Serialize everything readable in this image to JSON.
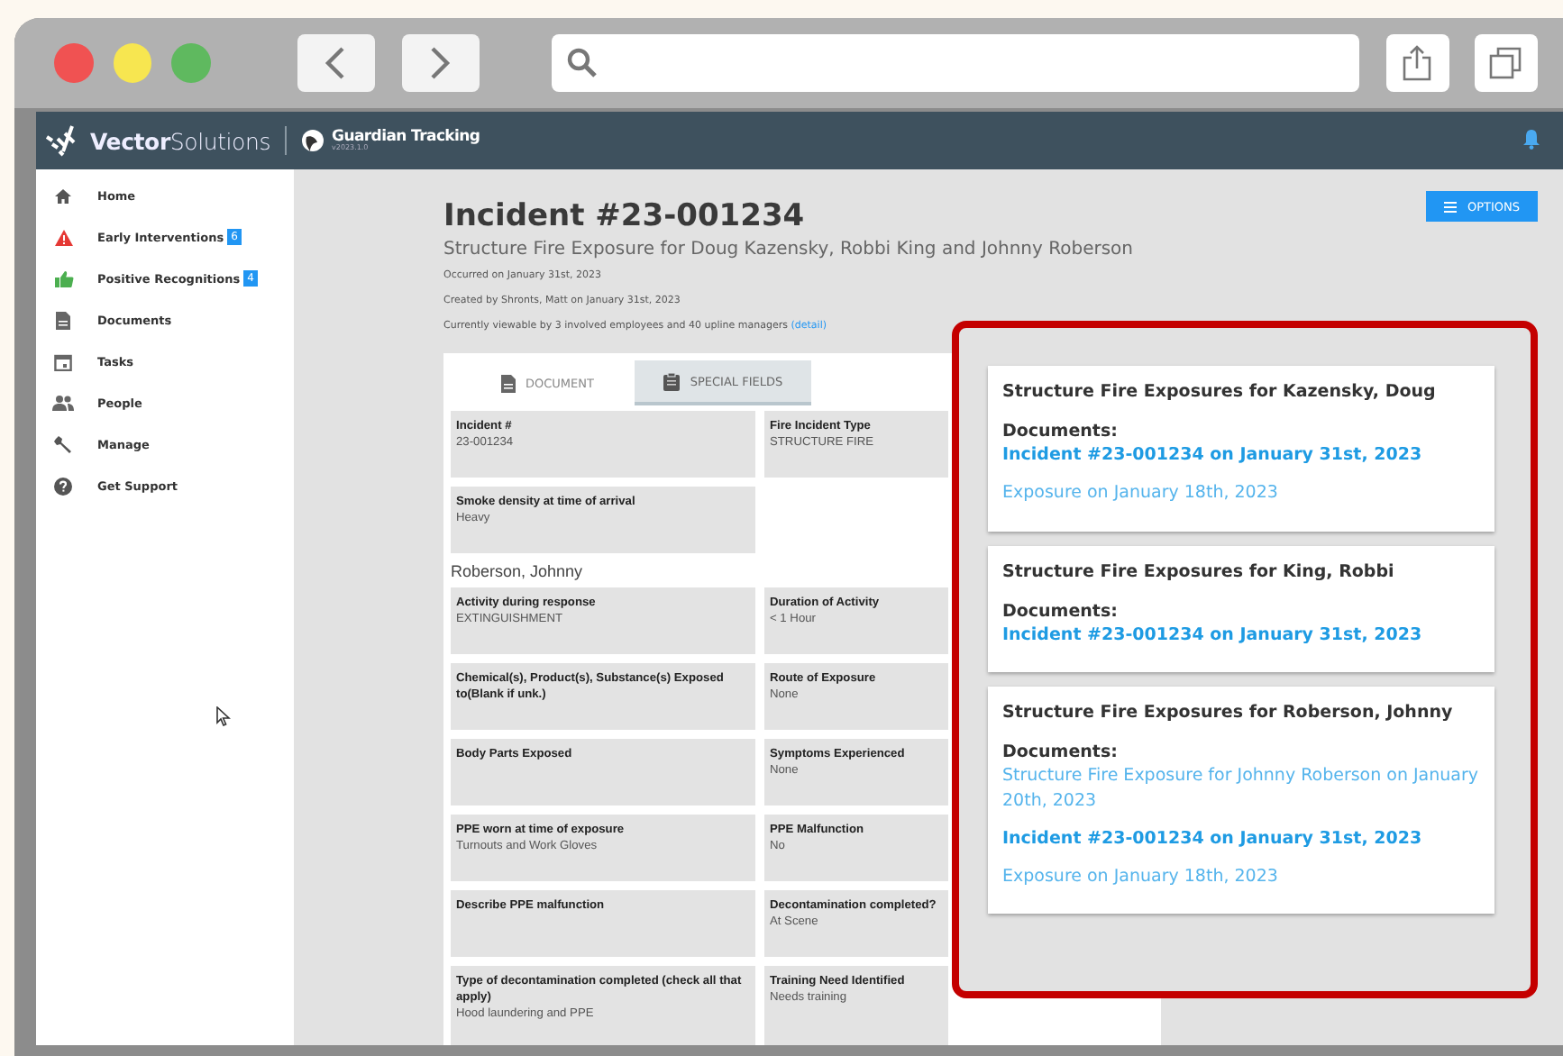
{
  "app": {
    "brand": "**Vector**Solutions",
    "product": "Guardian Tracking",
    "version": "v2023.1.0"
  },
  "sidebar": {
    "items": [
      {
        "label": "Home",
        "kind": "home"
      },
      {
        "label": "Early Interventions",
        "kind": "warning",
        "badge": "6"
      },
      {
        "label": "Positive Recognitions",
        "kind": "thumb",
        "badge": "4"
      },
      {
        "label": "Documents",
        "kind": "document"
      },
      {
        "label": "Tasks",
        "kind": "calendar"
      },
      {
        "label": "People",
        "kind": "people"
      },
      {
        "label": "Manage",
        "kind": "wrench"
      },
      {
        "label": "Get Support",
        "kind": "help"
      }
    ]
  },
  "incident": {
    "title": "Incident #23-001234",
    "subtitle": "Structure Fire Exposure for Doug Kazensky, Robbi King and Johnny Roberson",
    "meta": [
      "Occurred on January 31st, 2023",
      "Created by Shronts, Matt on January 31st, 2023"
    ],
    "viewable": {
      "text": "Currently viewable by 3 involved employees and 40 upline managers",
      "link": "(detail)"
    },
    "options_button": "OPTIONS",
    "tabs": [
      {
        "label": "DOCUMENT",
        "kind": "document",
        "selected": false
      },
      {
        "label": "SPECIAL FIELDS",
        "kind": "clipboard",
        "selected": true
      }
    ],
    "fields": [
      {
        "label": "Incident #",
        "value": "23-001234"
      },
      {
        "label": "Fire Incident Type",
        "value": "STRUCTURE FIRE"
      },
      {
        "label": "Smoke density at time of arrival",
        "value": "Heavy"
      }
    ],
    "sections": [
      {
        "heading": "Roberson, Johnny",
        "fields": [
          {
            "label": "Activity during response",
            "value": "EXTINGUISHMENT"
          },
          {
            "label": "Duration of Activity",
            "value": "< 1 Hour"
          },
          {
            "label": "Chemical(s), Product(s), Substance(s) Exposed to(Blank if unk.)"
          },
          {
            "label": "Route of Exposure",
            "value": "None"
          },
          {
            "label": "Body Parts Exposed"
          },
          {
            "label": "Symptoms Experienced",
            "value": "None"
          },
          {
            "label": "PPE worn at time of exposure",
            "value": "Turnouts and Work Gloves"
          },
          {
            "label": "PPE Malfunction",
            "value": "No"
          },
          {
            "label": "Describe PPE malfunction"
          },
          {
            "label": "Decontamination completed?",
            "value": "At Scene"
          },
          {
            "label": "Type of decontamination completed (check all that apply)",
            "value": "Hood laundering and PPE"
          },
          {
            "label": "Training Need Identified",
            "value": "Needs training"
          }
        ]
      }
    ]
  },
  "exposures": [
    {
      "title": "Structure Fire Exposures for Kazensky, Doug",
      "documents_label": "Documents:",
      "links": [
        {
          "text": "Incident #23-001234 on January 31st, 2023",
          "kind": "current"
        },
        {
          "text": "Exposure on January 18th, 2023",
          "kind": "other"
        }
      ]
    },
    {
      "title": "Structure Fire Exposures for King, Robbi",
      "documents_label": "Documents:",
      "links": [
        {
          "text": "Incident #23-001234 on January 31st, 2023",
          "kind": "current"
        }
      ]
    },
    {
      "title": "Structure Fire Exposures for Roberson, Johnny",
      "documents_label": "Documents:",
      "links": [
        {
          "text": "Structure Fire Exposure for Johnny Roberson on January 20th, 2023",
          "kind": "other"
        },
        {
          "text": "Incident #23-001234 on January 31st, 2023",
          "kind": "current"
        },
        {
          "text": "Exposure on January 18th, 2023",
          "kind": "other"
        }
      ]
    }
  ]
}
